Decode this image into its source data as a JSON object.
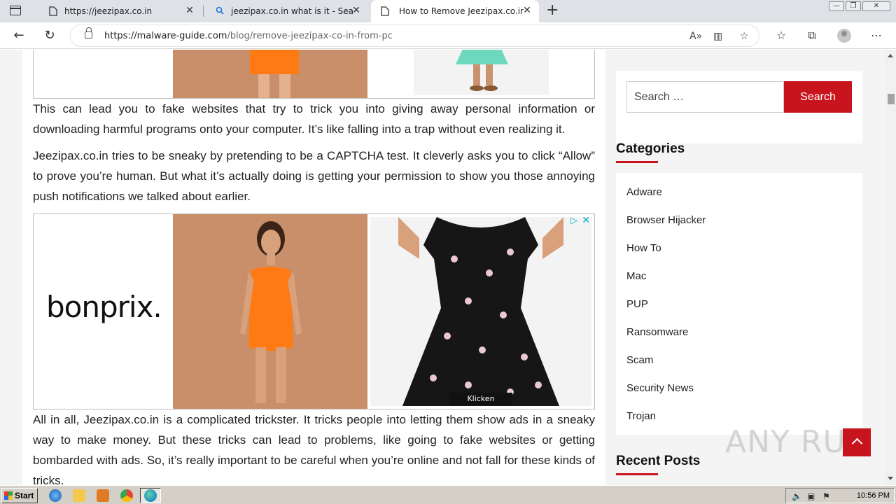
{
  "browser": {
    "tabs": [
      {
        "label": "https://jeezipax.co.in",
        "active": false
      },
      {
        "label": "jeezipax.co.in what is it - Search",
        "active": false
      },
      {
        "label": "How to Remove Jeezipax.co.in f",
        "active": true
      }
    ],
    "url_host": "https://malware-guide.com",
    "url_path": "/blog/remove-jeezipax-co-in-from-pc"
  },
  "article": {
    "paragraphs": [
      "This can lead you to fake websites that try to trick you into giving away personal information or downloading harmful programs onto your computer. It’s like falling into a trap without even realizing it.",
      "Jeezipax.co.in tries to be sneaky by pretending to be a CAPTCHA test. It cleverly asks you to click “Allow” to prove you’re human. But what it’s actually doing is getting your permission to show you those annoying push notifications we talked about earlier.",
      "All in all, Jeezipax.co.in is a complicated trickster. It tricks people into letting them show ads in a sneaky way to make money. But these tricks can lead to problems, like going to fake websites or getting bombarded with ads. So, it’s really important to be careful when you’re online and not fall for these kinds of tricks."
    ],
    "ad": {
      "brand": "bonprix.",
      "cta": "Klicken"
    }
  },
  "sidebar": {
    "search_placeholder": "Search …",
    "search_button": "Search",
    "categories_title": "Categories",
    "categories": [
      "Adware",
      "Browser Hijacker",
      "How To",
      "Mac",
      "PUP",
      "Ransomware",
      "Scam",
      "Security News",
      "Trojan"
    ],
    "recent_title": "Recent Posts"
  },
  "watermark": "ANY RUN",
  "taskbar": {
    "start": "Start",
    "clock": "10:56 PM"
  },
  "colors": {
    "accent": "#c8141d",
    "chrome_bg": "#dee1e6",
    "taskbar_bg": "#d4d0c8"
  }
}
